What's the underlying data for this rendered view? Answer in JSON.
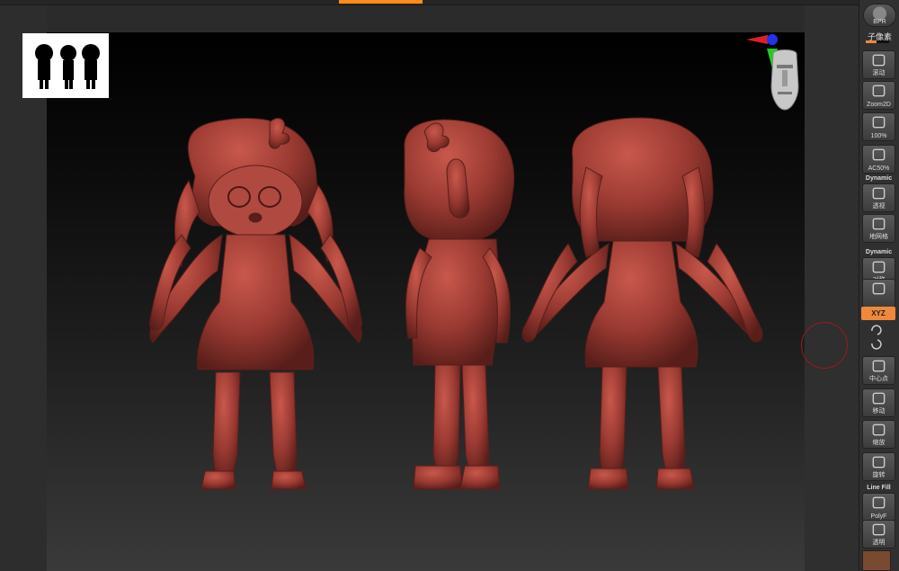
{
  "shelf": {
    "bpr_label": "BPR",
    "subpixel_label": "子像素",
    "items": [
      {
        "name": "scroll",
        "label": "滚动"
      },
      {
        "name": "zoom2d",
        "label": "Zoom2D"
      },
      {
        "name": "zoom100",
        "label": "100%"
      },
      {
        "name": "ac50",
        "label": "AC50%"
      },
      {
        "name": "perspective",
        "label": "透视",
        "heading": "Dynamic"
      },
      {
        "name": "floor",
        "label": "地网格"
      },
      {
        "name": "symmetry",
        "label": "对称",
        "heading": "Dynamic"
      },
      {
        "name": "lock",
        "label": ""
      },
      {
        "name": "center",
        "label": "中心点"
      },
      {
        "name": "move",
        "label": "移动"
      },
      {
        "name": "scale",
        "label": "缩放"
      },
      {
        "name": "rotate",
        "label": "旋转"
      },
      {
        "name": "polyf",
        "label": "PolyF",
        "heading": "Line Fill"
      },
      {
        "name": "transparent",
        "label": "透明"
      }
    ],
    "xyz_label": "XYZ"
  },
  "colors": {
    "accent": "#f0883a",
    "model": "#a8423a",
    "brush_ring": "#a01818"
  },
  "icons": {
    "gizmo": "axis-gizmo-icon",
    "head": "navigation-head-icon"
  }
}
